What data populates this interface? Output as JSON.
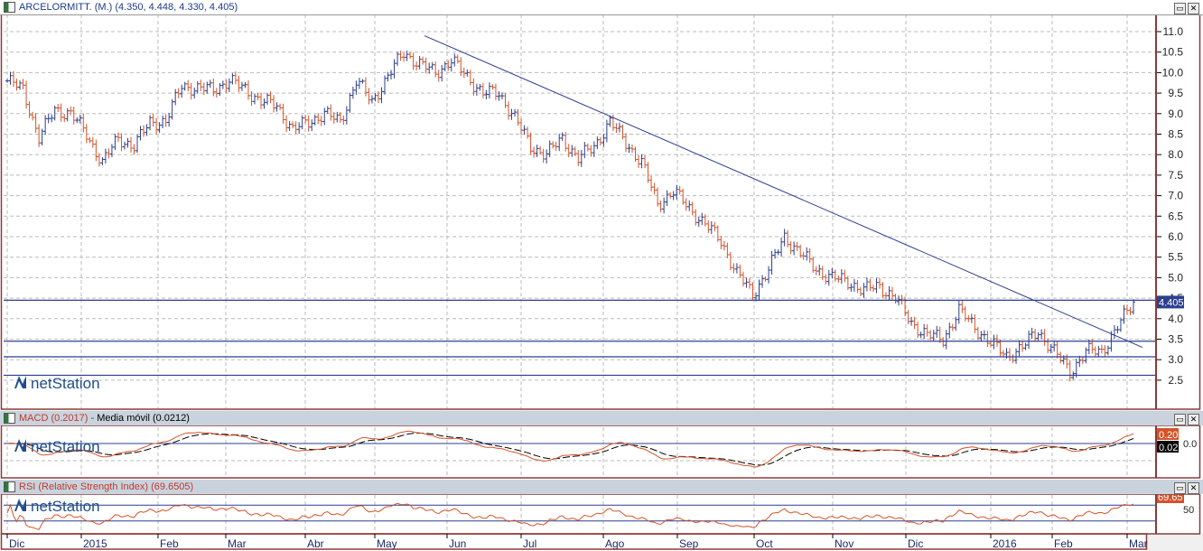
{
  "main_panel": {
    "title": "ARCELORMITT. (M.) (4.350, 4.448, 4.330, 4.405)",
    "last_price_label": "4.405"
  },
  "macd_panel": {
    "title": "MACD (0.2017)",
    "ma_title": "Media móvil (0.0212)",
    "macd_label": "0.20",
    "signal_label": "0.02",
    "zero_label": "0.0"
  },
  "rsi_panel": {
    "title": "RSI (Relative Strength Index) (69.6505)",
    "rsi_label": "69.65",
    "mid_label": "50"
  },
  "watermark": "netStation",
  "buttons": {
    "restore": "▭",
    "close": "✕"
  },
  "colors": {
    "up": "#2b3f8f",
    "down": "#d4532a",
    "line": "#2b3f8f",
    "macd": "#d4532a",
    "signal": "#000000",
    "border": "#8b3a3a"
  },
  "chart_data": {
    "type": "ohlc",
    "title": "ARCELORMITT. (M.)",
    "ylim": [
      2.0,
      11.2
    ],
    "y_ticks": [
      "11.0",
      "10.5",
      "10.0",
      "9.5",
      "9.0",
      "8.5",
      "8.0",
      "7.5",
      "7.0",
      "6.5",
      "6.0",
      "5.5",
      "5.0",
      "4.5",
      "4.0",
      "3.5",
      "3.0",
      "2.5"
    ],
    "x_labels": [
      "Dic",
      "2015",
      "Feb",
      "Mar",
      "Abr",
      "May",
      "Jun",
      "Jul",
      "Ago",
      "Sep",
      "Oct",
      "Nov",
      "Dic",
      "2016",
      "Feb",
      "Mar"
    ],
    "weekly_closes": [
      9.8,
      9.6,
      8.4,
      9.1,
      9.0,
      8.5,
      7.8,
      8.4,
      8.2,
      8.8,
      8.8,
      9.7,
      9.6,
      9.6,
      9.8,
      9.6,
      9.3,
      9.2,
      8.6,
      8.8,
      9.0,
      8.8,
      9.8,
      9.3,
      9.9,
      10.5,
      10.2,
      10.0,
      10.3,
      9.9,
      9.5,
      9.5,
      8.9,
      8.2,
      8.0,
      8.4,
      7.9,
      8.2,
      8.8,
      8.3,
      7.8,
      6.8,
      7.1,
      6.7,
      6.3,
      5.9,
      5.1,
      4.6,
      5.2,
      6.0,
      5.6,
      5.2,
      5.0,
      4.9,
      4.7,
      4.8,
      4.5,
      3.9,
      3.6,
      3.5,
      4.2,
      3.8,
      3.4,
      3.1,
      3.3,
      3.7,
      3.2,
      2.7,
      3.2,
      3.2,
      3.8,
      4.4
    ],
    "last_ohlc": {
      "open": 4.35,
      "high": 4.448,
      "low": 4.33,
      "close": 4.405
    },
    "horizontal_lines": [
      4.45,
      3.45,
      3.07,
      2.62
    ],
    "trendline": {
      "from": 10.9,
      "to": 3.3
    },
    "macd": {
      "last": 0.2017,
      "signal": 0.0212
    },
    "rsi": {
      "last": 69.6505,
      "levels": [
        70,
        30
      ]
    }
  }
}
